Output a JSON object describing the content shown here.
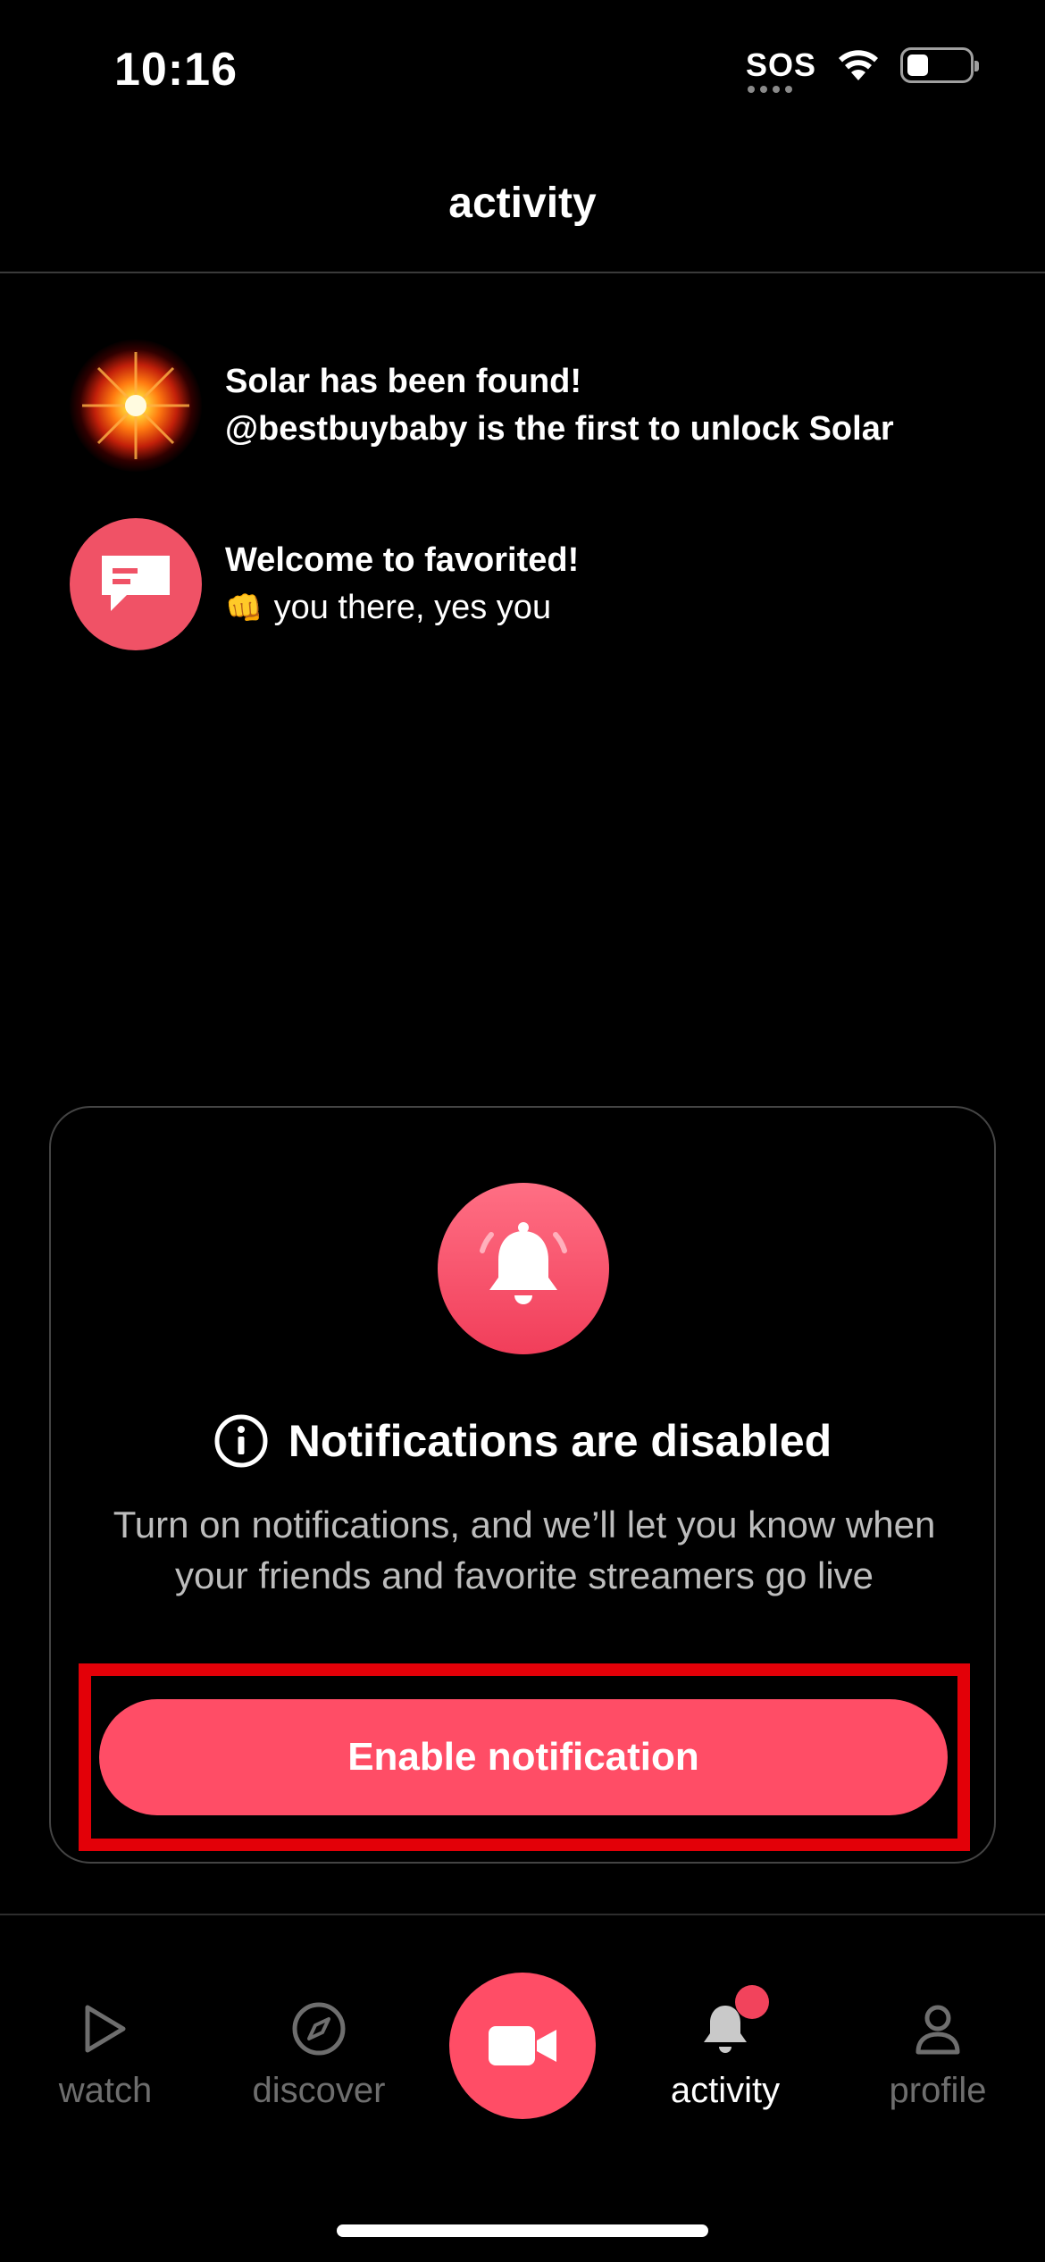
{
  "status_bar": {
    "time": "10:16",
    "sos": "SOS",
    "battery_level": 0.35
  },
  "header": {
    "title": "activity"
  },
  "activity": {
    "items": [
      {
        "title": "Solar has been found!",
        "subtitle": "@bestbuybaby is the first to unlock Solar",
        "icon": "solar-burst-icon"
      },
      {
        "title": "Welcome to favorited!",
        "emoji": "👊",
        "subtitle": "you there, yes you",
        "icon": "chat-bubble-icon"
      }
    ]
  },
  "notifications_card": {
    "title": "Notifications are disabled",
    "body": "Turn on notifications, and we’ll let you know when your friends and favorite streamers go live",
    "button_label": "Enable notification"
  },
  "tab_bar": {
    "tabs": [
      {
        "label": "watch",
        "icon": "play-icon"
      },
      {
        "label": "discover",
        "icon": "compass-icon"
      },
      {
        "label": "activity",
        "icon": "bell-icon",
        "active": true
      },
      {
        "label": "profile",
        "icon": "person-icon"
      }
    ],
    "center_icon": "video-camera-icon"
  },
  "colors": {
    "accent": "#ff4d66",
    "background": "#000000",
    "highlight": "#e30008",
    "muted_text": "#bdbdbd",
    "inactive_tab": "#6e6e6e"
  }
}
